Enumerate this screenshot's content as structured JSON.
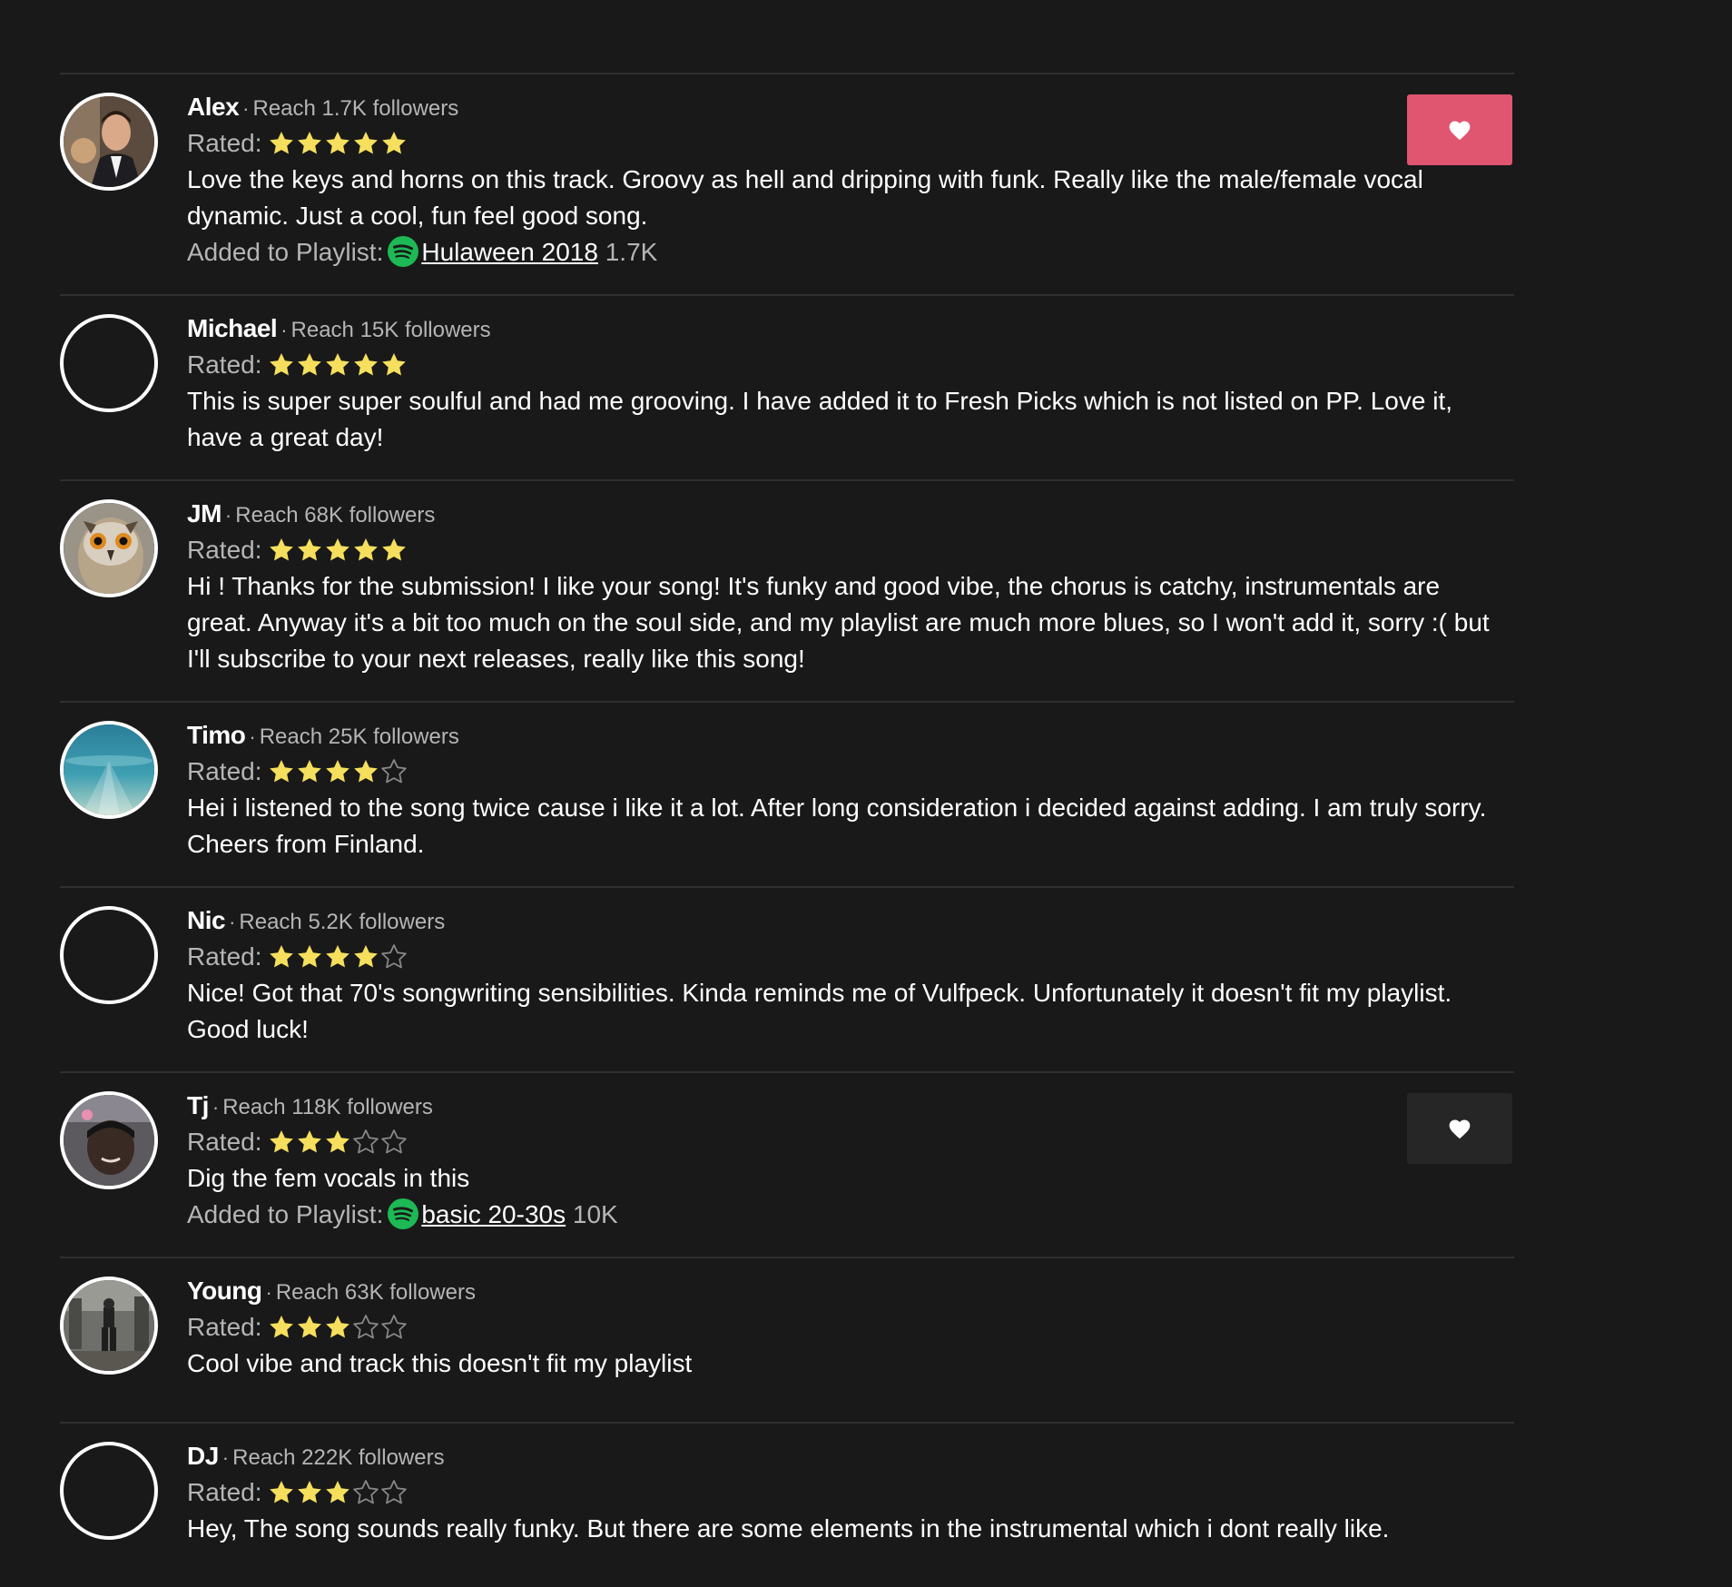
{
  "rated_label": "Rated:",
  "added_label": "Added to Playlist:",
  "colors": {
    "background": "#191919",
    "star_filled": "#f5df5d",
    "star_empty": "#8a8a8a",
    "heart_active_bg": "#e05570",
    "heart_inactive_bg": "#262626",
    "spotify_green": "#1db954",
    "muted_text": "#b5b5b5"
  },
  "reviews": [
    {
      "name": "Alex",
      "reach": "Reach 1.7K followers",
      "rating": 5,
      "avatar": "photo-man-suit",
      "comment": "Love the keys and horns on this track. Groovy as hell and dripping with funk. Really like the male/female vocal dynamic. Just a cool, fun feel good song.",
      "playlist": {
        "name": "Hulaween 2018",
        "followers": "1.7K"
      },
      "heart": "active"
    },
    {
      "name": "Michael",
      "reach": "Reach 15K followers",
      "rating": 5,
      "avatar": "empty",
      "comment": "This is super super soulful and had me grooving. I have added it to Fresh Picks which is not listed on PP. Love it, have a great day!"
    },
    {
      "name": "JM",
      "reach": "Reach 68K followers",
      "rating": 5,
      "avatar": "photo-owl",
      "comment": "Hi ! Thanks for the submission! I like your song! It's funky and good vibe, the chorus is catchy, instrumentals are great. Anyway it's a bit too much on the soul side, and my playlist are much more blues, so I won't add it, sorry :( but I'll subscribe to your next releases, really like this song!"
    },
    {
      "name": "Timo",
      "reach": "Reach 25K followers",
      "rating": 4,
      "avatar": "photo-underwater",
      "comment": "Hei i listened to the song twice cause i like it a lot. After long consideration i decided against adding. I am truly sorry. Cheers from Finland."
    },
    {
      "name": "Nic",
      "reach": "Reach 5.2K followers",
      "rating": 4,
      "avatar": "empty",
      "comment": "Nice! Got that 70's songwriting sensibilities. Kinda reminds me of Vulfpeck. Unfortunately it doesn't fit my playlist. Good luck!"
    },
    {
      "name": "Tj",
      "reach": "Reach 118K followers",
      "rating": 3,
      "avatar": "photo-person-dark",
      "comment": "Dig the fem vocals in this",
      "playlist": {
        "name": "basic 20-30s",
        "followers": "10K"
      },
      "heart": "inactive"
    },
    {
      "name": "Young",
      "reach": "Reach 63K followers",
      "rating": 3,
      "avatar": "photo-ruins",
      "comment": "Cool vibe and track this doesn't fit my playlist"
    },
    {
      "name": "DJ",
      "reach": "Reach 222K followers",
      "rating": 3,
      "avatar": "empty",
      "comment": "Hey, The song sounds really funky. But there are some elements in the instrumental which i dont really like."
    }
  ]
}
